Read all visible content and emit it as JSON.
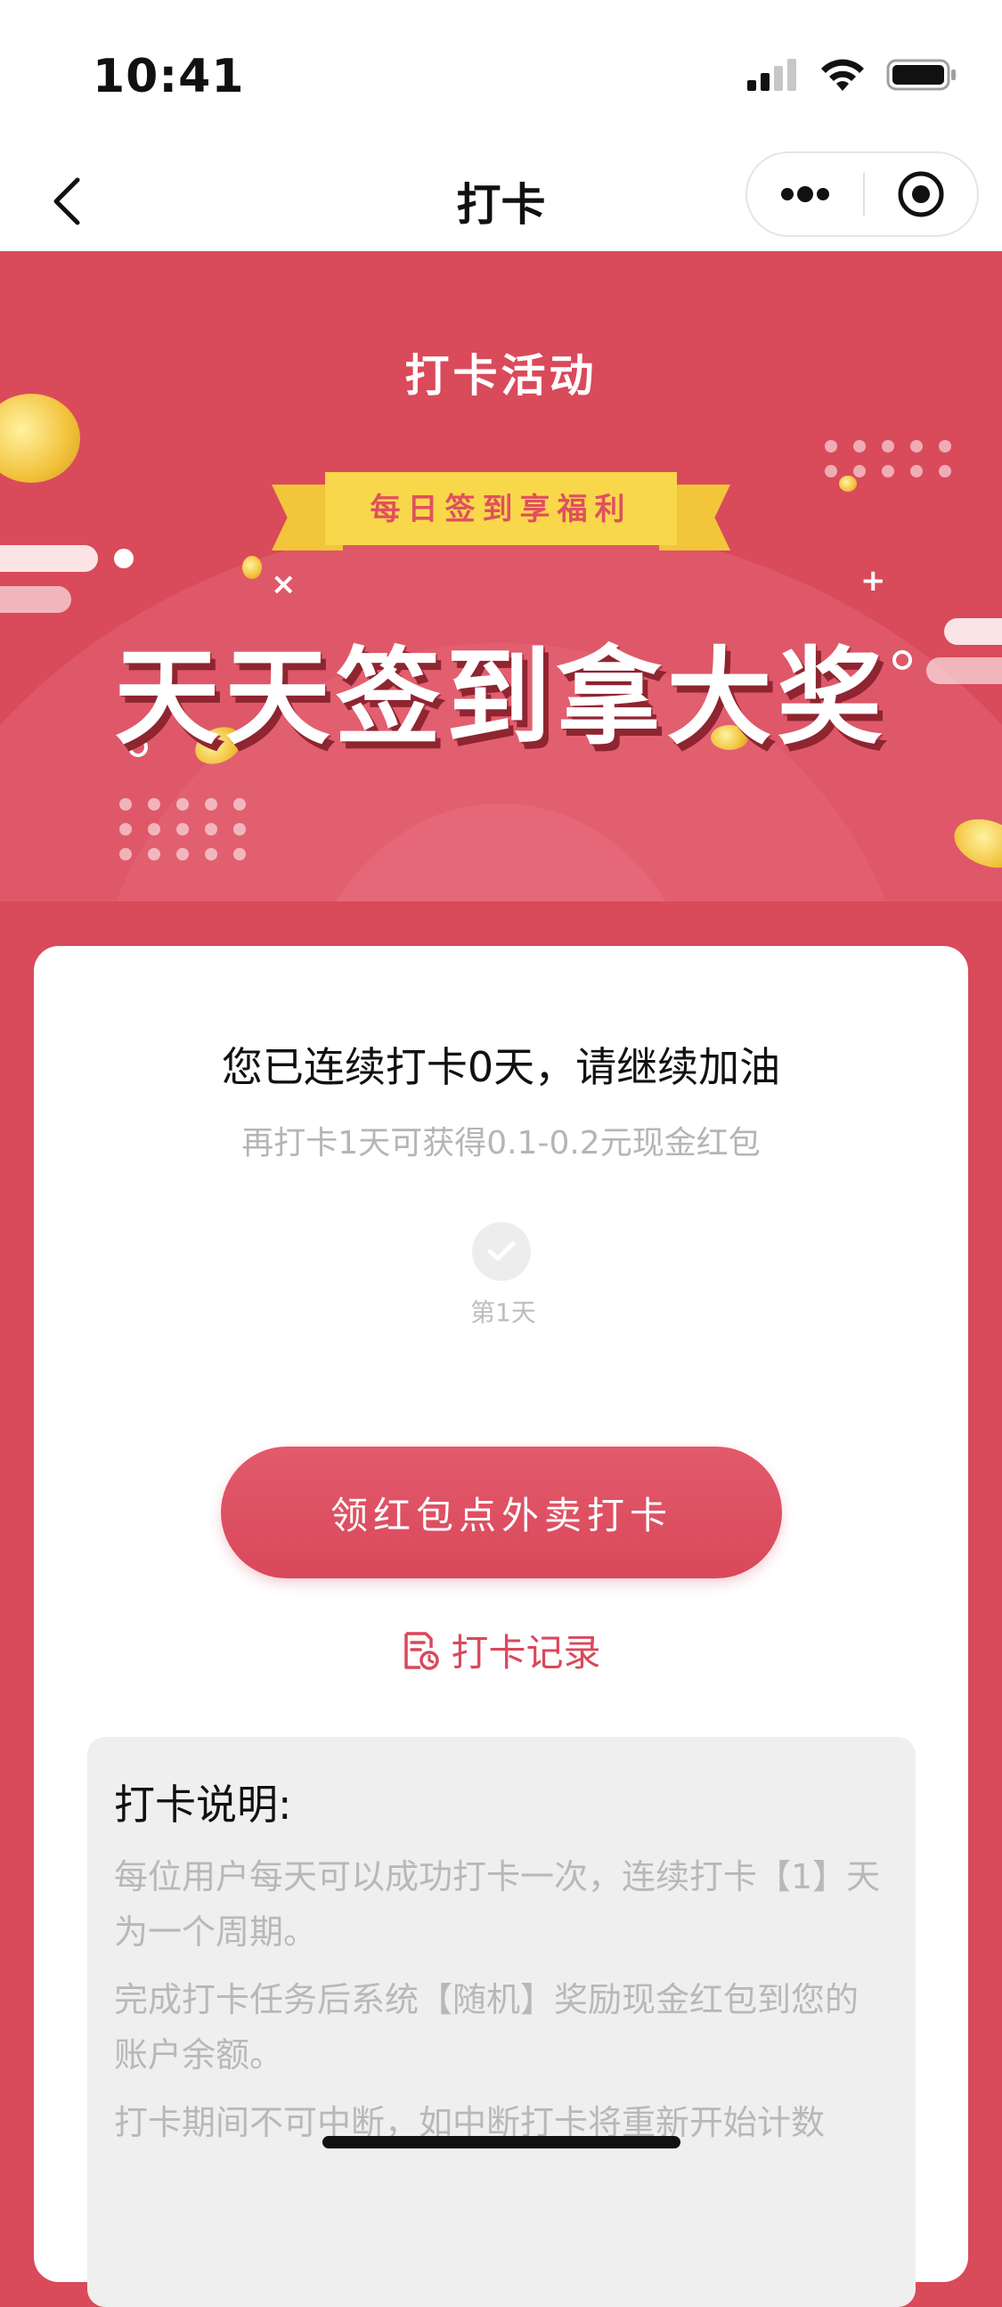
{
  "status_bar": {
    "time": "10:41"
  },
  "nav": {
    "title": "打卡"
  },
  "banner": {
    "title": "打卡活动",
    "ribbon": "每日签到享福利",
    "headline": "天天签到拿大奖"
  },
  "card": {
    "streak_text": "您已连续打卡0天，请继续加油",
    "reward_text": "再打卡1天可获得0.1-0.2元现金红包",
    "days": [
      {
        "label": "第1天",
        "checked": false
      }
    ],
    "cta_label": "领红包点外卖打卡",
    "records_label": "打卡记录"
  },
  "rules": {
    "title": "打卡说明:",
    "items": [
      "每位用户每天可以成功打卡一次，连续打卡【1】天为一个周期。",
      "完成打卡任务后系统【随机】奖励现金红包到您的账户余额。",
      "打卡期间不可中断，如中断打卡将重新开始计数"
    ]
  },
  "colors": {
    "brand_red": "#d94a5b",
    "ribbon_yellow": "#f8d84a",
    "card_bg": "#ffffff",
    "muted_text": "#b8b8b8"
  }
}
